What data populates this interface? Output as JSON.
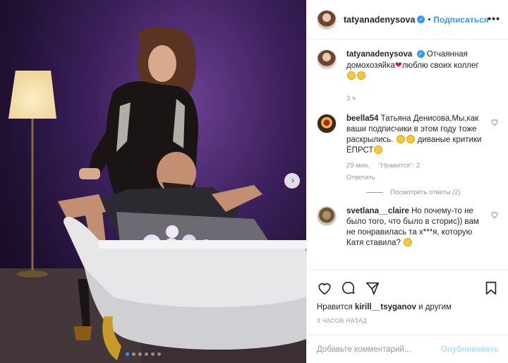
{
  "header": {
    "username": "tatyanadenysova",
    "separator": "•",
    "follow_label": "Подписаться",
    "more_icon": "•••"
  },
  "photo": {
    "next_icon": "›",
    "dot_count": 6,
    "active_dot": 0
  },
  "caption": {
    "username": "tatyanadenysova",
    "text_before": "Отчаянная домохозяйка",
    "heart": "❤",
    "text_after": "люблю своих коллег",
    "time": "3 ч"
  },
  "comments": [
    {
      "username": "beella54",
      "text_a": "Татьяна Денисова,Мы,как ваши подписчики в этом году тоже раскрылись.",
      "text_b": "диваные критики ЁПРСТ",
      "time": "29 мин.",
      "likes": "\"Нравится\": 2",
      "reply": "Ответить",
      "view_replies": "Посмотреть ответы (2)"
    },
    {
      "username": "svetlana__claire",
      "text": "Но почему-то не было того, что было в сторис)) вам не понравилась та х***я, которую Катя ставила?"
    }
  ],
  "actions": {
    "icons": [
      "heart-icon",
      "comment-icon",
      "share-icon",
      "bookmark-icon"
    ],
    "likes_prefix": "Нравится",
    "likes_user": "kirill__tsyganov",
    "likes_suffix": "и другим",
    "posted_time": "3 часов назад"
  },
  "comment_input": {
    "placeholder": "Добавьте комментарий...",
    "publish_label": "Опубликовать"
  },
  "colors": {
    "accent": "#3897f0",
    "publish_disabled": "#b2dffc",
    "muted": "#999999",
    "text": "#262626"
  }
}
